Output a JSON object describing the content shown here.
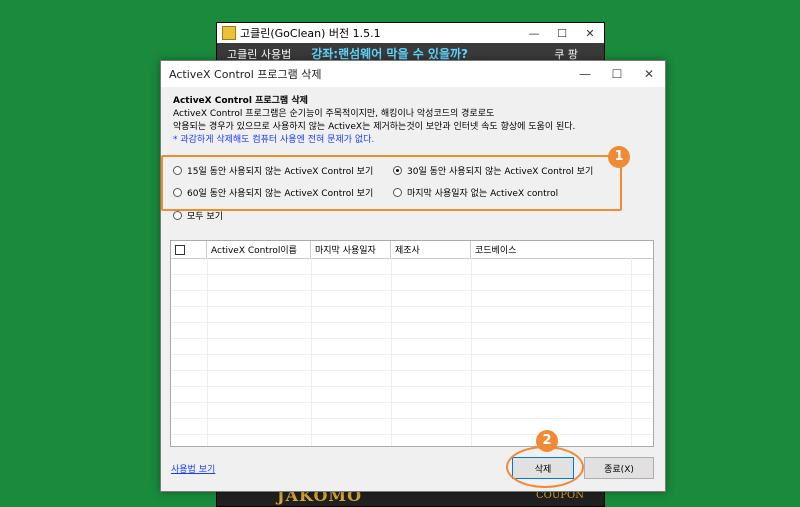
{
  "background_window": {
    "title": "고클린(GoClean) 버전 1.5.1",
    "controls": [
      "—",
      "☐",
      "✕"
    ],
    "menu": {
      "usage": "고클린 사용법",
      "lecture": "강좌:랜섬웨어 막을 수 있을까?",
      "coupon": "쿠 팡"
    },
    "banner": {
      "brand": "JAKOMO",
      "coupon": "COUPON"
    }
  },
  "dialog": {
    "title": "ActiveX Control 프로그램 삭제",
    "controls": [
      "—",
      "☐",
      "✕"
    ],
    "heading": "ActiveX Control 프로그램 삭제",
    "desc1": "ActiveX Control 프로그램은 순기능이 주목적이지만, 해킹이나 악성코드의 경로로도",
    "desc2": "악용되는 경우가 있으므로 사용하지 않는 ActiveX는 제거하는것이 보안과 인터넷 속도 향상에 도움이 된다.",
    "note": "* 과감하게 삭제해도 컴퓨터 사용엔 전혀 문제가 없다.",
    "options": {
      "opt15": "15일 동안 사용되지 않는 ActiveX Control 보기",
      "opt30": "30일 동안 사용되지 않는 ActiveX Control 보기",
      "opt60": "60일 동안 사용되지 않는 ActiveX Control 보기",
      "optnone": "마지막 사용일자 없는 ActiveX control",
      "optall": "모두 보기",
      "selected": "opt30"
    },
    "table": {
      "columns": [
        "ActiveX Control이름",
        "마지막 사용일자",
        "제조사",
        "코드베이스"
      ],
      "rows": []
    },
    "link": "사용법 보기",
    "delete_label": "삭제",
    "exit_label": "종료(X)"
  },
  "annotations": {
    "badge1": "1",
    "badge2": "2",
    "accent": "#f08a35"
  }
}
